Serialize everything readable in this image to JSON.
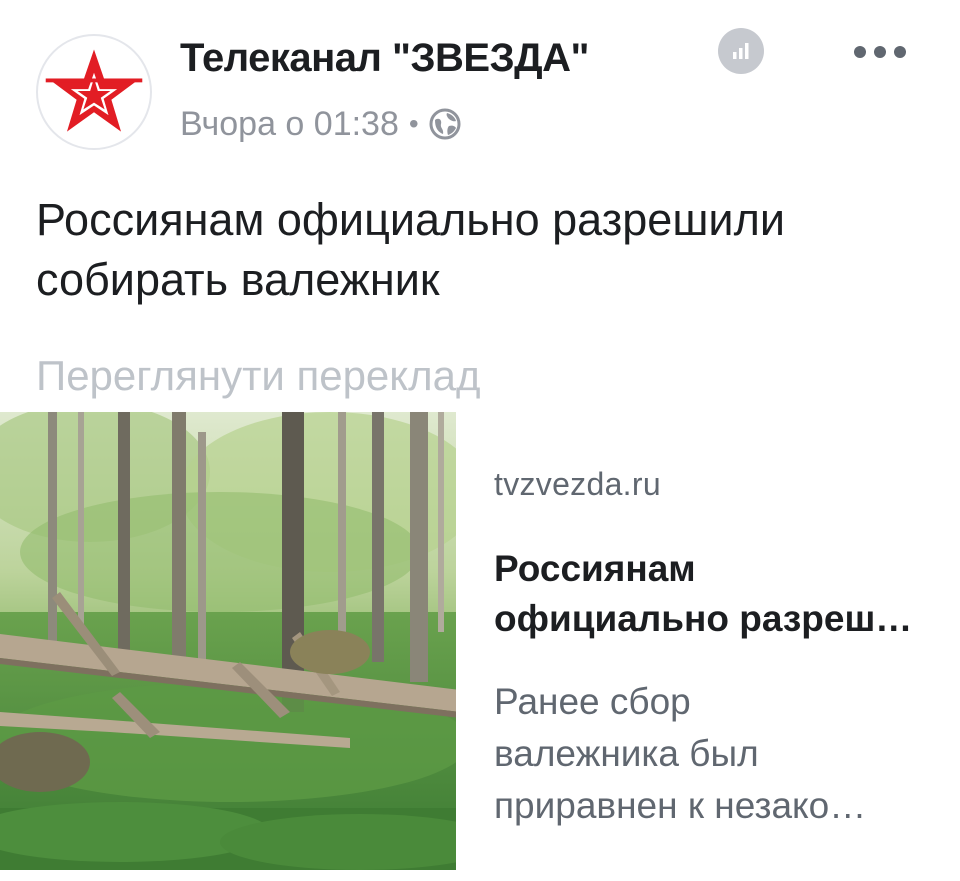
{
  "post": {
    "page_name": "Телеканал \"ЗВЕЗДА\"",
    "timestamp": "Вчора о 01:38",
    "separator": "•",
    "privacy_icon": "globe-icon",
    "stats_icon": "bar-chart-icon",
    "more_icon": "more-options-icon",
    "avatar_icon": "red-star-logo",
    "text": "Россиянам официально разрешили\nсобирать валежник",
    "translate_label": "Переглянути переклад"
  },
  "link_card": {
    "domain": "tvzvezda.ru",
    "title": "Россиянам\nофициально разреш…",
    "description": "Ранее сбор\nвалежника был\nприравнен к незако…",
    "image": "forest-deadwood-photo"
  },
  "colors": {
    "text_primary": "#1c1e21",
    "text_secondary": "#90949c",
    "translate_gray": "#bec3c9",
    "brand_red": "#e21d24"
  }
}
